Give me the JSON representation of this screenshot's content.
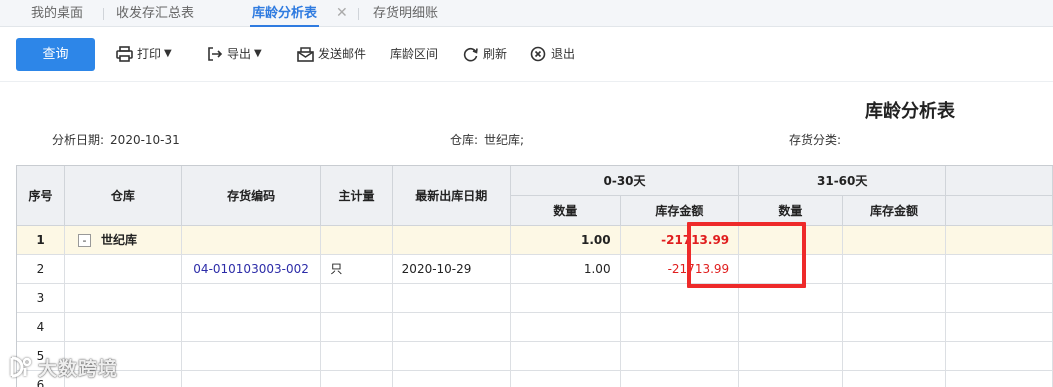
{
  "tabs": [
    {
      "label": "我的桌面",
      "active": false
    },
    {
      "label": "收发存汇总表",
      "active": false
    },
    {
      "label": "库龄分析表",
      "active": true,
      "closable": true
    },
    {
      "label": "存货明细账",
      "active": false
    }
  ],
  "tab_close_glyph": "✕",
  "toolbar": {
    "query_label": "查询",
    "print_label": "打印",
    "export_label": "导出",
    "send_mail_label": "发送邮件",
    "age_range_label": "库龄区间",
    "refresh_label": "刷新",
    "exit_label": "退出"
  },
  "report": {
    "title": "库龄分析表",
    "analysis_date_label": "分析日期:",
    "analysis_date": "2020-10-31",
    "warehouse_label": "仓库:",
    "warehouse": "世纪库;",
    "category_label": "存货分类:",
    "category": ""
  },
  "table": {
    "headers": {
      "seq": "序号",
      "warehouse": "仓库",
      "code": "存货编码",
      "unit": "主计量",
      "last_out_date": "最新出库日期",
      "group1": "0-30天",
      "group2": "31-60天",
      "qty": "数量",
      "amount": "库存金额"
    },
    "collapse_glyph": "-",
    "rows": [
      {
        "seq": "1",
        "warehouse": "世纪库",
        "code": "",
        "unit": "",
        "date": "",
        "qty1": "1.00",
        "amt1": "-21713.99",
        "qty2": "",
        "amt2": ""
      },
      {
        "seq": "2",
        "warehouse": "",
        "code": "04-010103003-002",
        "unit": "只",
        "date": "2020-10-29",
        "qty1": "1.00",
        "amt1": "-21713.99",
        "qty2": "",
        "amt2": ""
      },
      {
        "seq": "3",
        "warehouse": "",
        "code": "",
        "unit": "",
        "date": "",
        "qty1": "",
        "amt1": "",
        "qty2": "",
        "amt2": ""
      },
      {
        "seq": "4",
        "warehouse": "",
        "code": "",
        "unit": "",
        "date": "",
        "qty1": "",
        "amt1": "",
        "qty2": "",
        "amt2": ""
      },
      {
        "seq": "5",
        "warehouse": "",
        "code": "",
        "unit": "",
        "date": "",
        "qty1": "",
        "amt1": "",
        "qty2": "",
        "amt2": ""
      },
      {
        "seq": "6",
        "warehouse": "",
        "code": "",
        "unit": "",
        "date": "",
        "qty1": "",
        "amt1": "",
        "qty2": "",
        "amt2": ""
      }
    ]
  },
  "watermark": "大数跨境",
  "colors": {
    "accent": "#2d86e8",
    "negative": "#e01e1e",
    "highlight_border": "#ee2a2a",
    "selected_row": "#fdf8e5"
  }
}
